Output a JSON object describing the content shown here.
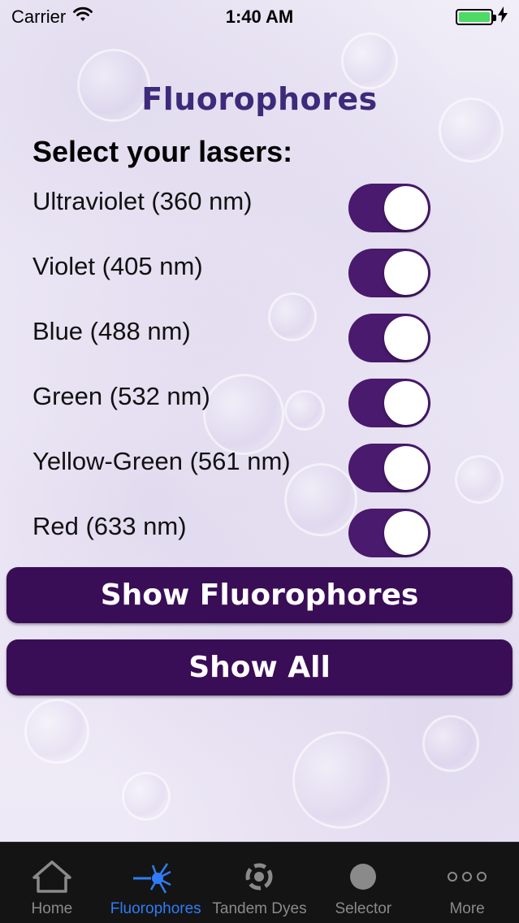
{
  "status_bar": {
    "carrier": "Carrier",
    "time": "1:40 AM",
    "battery_color": "#4cd964"
  },
  "page": {
    "title": "Fluorophores",
    "section_heading": "Select your lasers:"
  },
  "lasers": [
    {
      "label": "Ultraviolet (360 nm)",
      "enabled": true
    },
    {
      "label": "Violet (405 nm)",
      "enabled": true
    },
    {
      "label": "Blue (488 nm)",
      "enabled": true
    },
    {
      "label": "Green (532 nm)",
      "enabled": true
    },
    {
      "label": "Yellow-Green (561 nm)",
      "enabled": true
    },
    {
      "label": "Red (633 nm)",
      "enabled": true
    }
  ],
  "buttons": {
    "show_fluorophores": "Show Fluorophores",
    "show_all": "Show All"
  },
  "tab_bar": {
    "active_color": "#2f7cf6",
    "tabs": [
      {
        "label": "Home",
        "icon": "home-icon",
        "active": false
      },
      {
        "label": "Fluorophores",
        "icon": "laser-burst-icon",
        "active": true
      },
      {
        "label": "Tandem Dyes",
        "icon": "tandem-dye-icon",
        "active": false
      },
      {
        "label": "Selector",
        "icon": "circle-icon",
        "active": false
      },
      {
        "label": "More",
        "icon": "more-dots-icon",
        "active": false
      }
    ]
  },
  "colors": {
    "accent": "#3a0d57",
    "toggle_on": "#4a1a6e",
    "title": "#3d2a7a"
  }
}
